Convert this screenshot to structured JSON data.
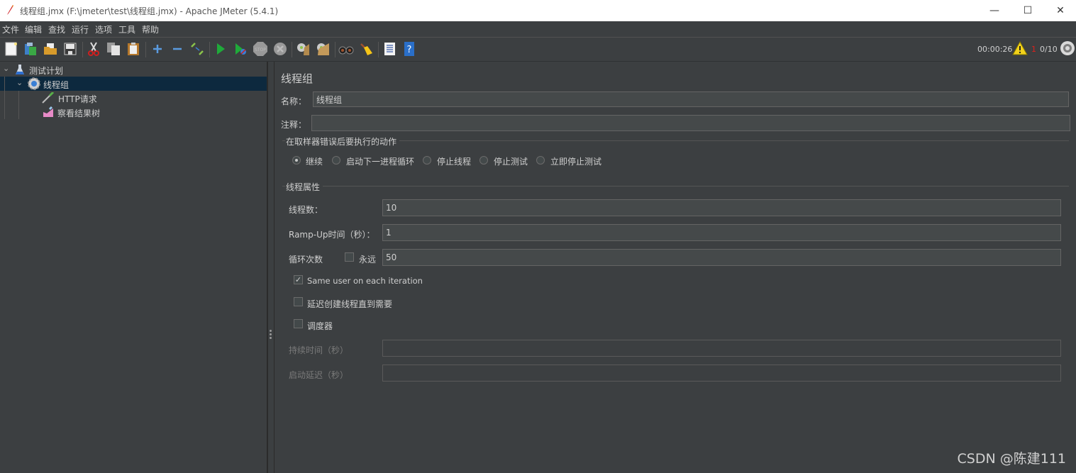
{
  "window": {
    "title": "线程组.jmx (F:\\jmeter\\test\\线程组.jmx) - Apache JMeter (5.4.1)",
    "minimize": "—",
    "maximize": "☐",
    "close": "✕"
  },
  "menu": [
    "文件",
    "编辑",
    "查找",
    "运行",
    "选项",
    "工具",
    "帮助"
  ],
  "toolbar": {
    "icons": [
      "new-icon",
      "templates-icon",
      "open-icon",
      "save-icon",
      "cut-icon",
      "copy-icon",
      "paste-icon",
      "expand-icon",
      "collapse-icon",
      "toggle-icon",
      "start-icon",
      "start-no-timers-icon",
      "stop-icon",
      "shutdown-icon",
      "clear-icon",
      "clear-all-icon",
      "search-icon",
      "reset-search-icon",
      "function-helper-icon",
      "help-icon"
    ],
    "elapsed_time": "00:00:26",
    "warning_count": "1",
    "threads": "0/10"
  },
  "tree": {
    "items": [
      {
        "label": "测试计划",
        "icon": "test-plan-icon"
      },
      {
        "label": "线程组",
        "icon": "thread-group-icon"
      },
      {
        "label": "HTTP请求",
        "icon": "sampler-icon"
      },
      {
        "label": "察看结果树",
        "icon": "listener-icon"
      }
    ]
  },
  "main": {
    "title": "线程组",
    "name_label": "名称：",
    "name_value": "线程组",
    "comment_label": "注释：",
    "comment_value": "",
    "error_action": {
      "title": "在取样器错误后要执行的动作",
      "options": [
        "继续",
        "启动下一进程循环",
        "停止线程",
        "停止测试",
        "立即停止测试"
      ],
      "selected": "继续"
    },
    "thread_props": {
      "title": "线程属性",
      "threads_label": "线程数：",
      "threads_value": "10",
      "rampup_label": "Ramp-Up时间（秒）：",
      "rampup_value": "1",
      "loop_label": "循环次数",
      "forever_label": "永远",
      "forever_checked": false,
      "loop_value": "50",
      "same_user_label": "Same user on each iteration",
      "same_user_checked": true,
      "delay_label": "延迟创建线程直到需要",
      "delay_checked": false,
      "scheduler_label": "调度器",
      "scheduler_checked": false,
      "duration_label": "持续时间（秒）",
      "duration_value": "",
      "startup_delay_label": "启动延迟（秒）",
      "startup_delay_value": ""
    }
  },
  "watermark": "CSDN @陈建111"
}
